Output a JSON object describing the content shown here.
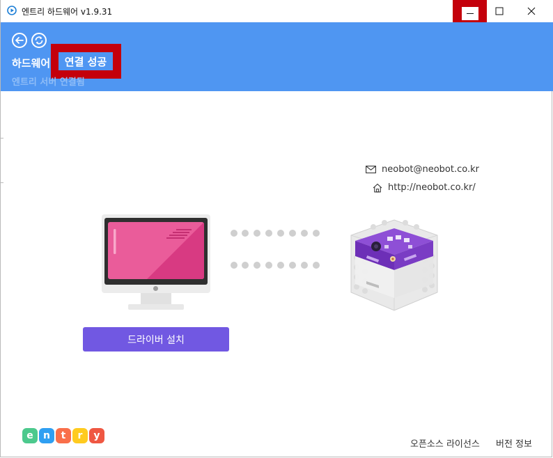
{
  "window": {
    "title": "엔트리 하드웨어 v1.9.31",
    "buttons": {
      "minimize": "minimize-icon",
      "maximize": "maximize-icon",
      "close": "close-icon"
    }
  },
  "header": {
    "back_icon": "arrow-left-icon",
    "refresh_icon": "refresh-icon",
    "title": "하드웨어",
    "status": "연결 성공",
    "server_status": "엔트리 서버 연결됨"
  },
  "contact": {
    "email": "neobot@neobot.co.kr",
    "homepage": "http://neobot.co.kr/",
    "email_icon": "mail-icon",
    "home_icon": "home-icon"
  },
  "main": {
    "driver_button": "드라이버 설치"
  },
  "footer": {
    "logo_letters": [
      "e",
      "n",
      "t",
      "r",
      "y"
    ],
    "logo_colors": [
      "#4cc98d",
      "#2f9ff2",
      "#f96f4a",
      "#ffcb1f",
      "#ef5742"
    ],
    "license": "오픈소스 라이선스",
    "version": "버전 정보"
  },
  "colors": {
    "header_bg": "#4f96f2",
    "accent_button": "#7158e2",
    "highlight_box": "#c4000b"
  }
}
